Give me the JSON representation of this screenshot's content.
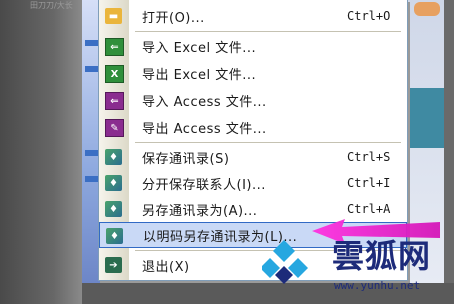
{
  "background": {
    "top_text": "田刀刀/大长"
  },
  "menu": {
    "items": [
      {
        "label": "打开(O)...",
        "shortcut": "Ctrl+O",
        "icon": "open-folder-icon"
      },
      {
        "label": "导入 Excel 文件...",
        "shortcut": "",
        "icon": "import-excel-icon"
      },
      {
        "label": "导出 Excel 文件...",
        "shortcut": "",
        "icon": "export-excel-icon"
      },
      {
        "label": "导入 Access 文件...",
        "shortcut": "",
        "icon": "import-access-icon"
      },
      {
        "label": "导出 Access 文件...",
        "shortcut": "",
        "icon": "export-access-icon"
      },
      {
        "label": "保存通讯录(S)",
        "shortcut": "Ctrl+S",
        "icon": "save-contacts-icon"
      },
      {
        "label": "分开保存联系人(I)...",
        "shortcut": "Ctrl+I",
        "icon": "save-separately-icon"
      },
      {
        "label": "另存通讯录为(A)...",
        "shortcut": "Ctrl+A",
        "icon": "save-as-icon"
      },
      {
        "label": "以明码另存通讯录为(L)...",
        "shortcut": "",
        "icon": "save-plaintext-icon"
      },
      {
        "label": "退出(X)",
        "shortcut": "",
        "icon": "exit-icon"
      }
    ]
  },
  "watermark": {
    "brand": "雲狐网",
    "url": "www.yunhu.net"
  },
  "colors": {
    "highlight": "#c9d9f6",
    "highlight_border": "#316ac5",
    "arrow": "#e020c8",
    "watermark": "#1d2b7a"
  }
}
